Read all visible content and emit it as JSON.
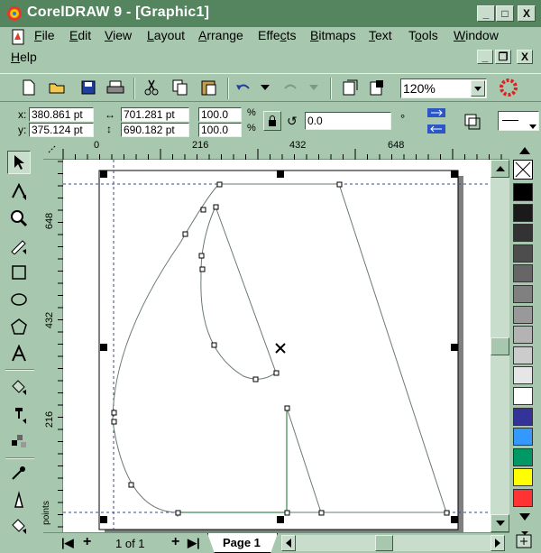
{
  "title": "CorelDRAW 9 - [Graphic1]",
  "window_buttons": {
    "minimize": "_",
    "maximize": "□",
    "close": "X"
  },
  "menu": [
    "File",
    "Edit",
    "View",
    "Layout",
    "Arrange",
    "Effects",
    "Bitmaps",
    "Text",
    "Tools",
    "Window",
    "Help"
  ],
  "menu_underline": [
    "F",
    "E",
    "V",
    "L",
    "A",
    "c",
    "B",
    "T",
    "o",
    "W",
    "H"
  ],
  "toolbar": {
    "zoom_value": "120%"
  },
  "property_bar": {
    "x_label": "x:",
    "x_value": "380.861 pt",
    "y_label": "y:",
    "y_value": "375.124 pt",
    "width_value": "701.281 pt",
    "height_value": "690.182 pt",
    "scale_x": "100.0",
    "scale_y": "100.0",
    "percent": "%",
    "rotation_value": "0.0",
    "degree": "°"
  },
  "ruler": {
    "h_ticks": [
      "0",
      "216",
      "432",
      "648"
    ],
    "v_ticks": [
      "648",
      "432",
      "216"
    ],
    "units": "points"
  },
  "status": {
    "page_counter": "1 of 1",
    "page_tab": "Page 1"
  },
  "colors": {
    "ui": "#a7c7ae",
    "title": "#54855f",
    "palette": [
      "#000000",
      "#1a1a1a",
      "#333333",
      "#4d4d4d",
      "#666666",
      "#808080",
      "#999999",
      "#b3b3b3",
      "#cccccc",
      "#e6e6e6",
      "#ffffff",
      "#333399",
      "#3399ff",
      "#009966",
      "#ffff00",
      "#ff3333"
    ]
  }
}
